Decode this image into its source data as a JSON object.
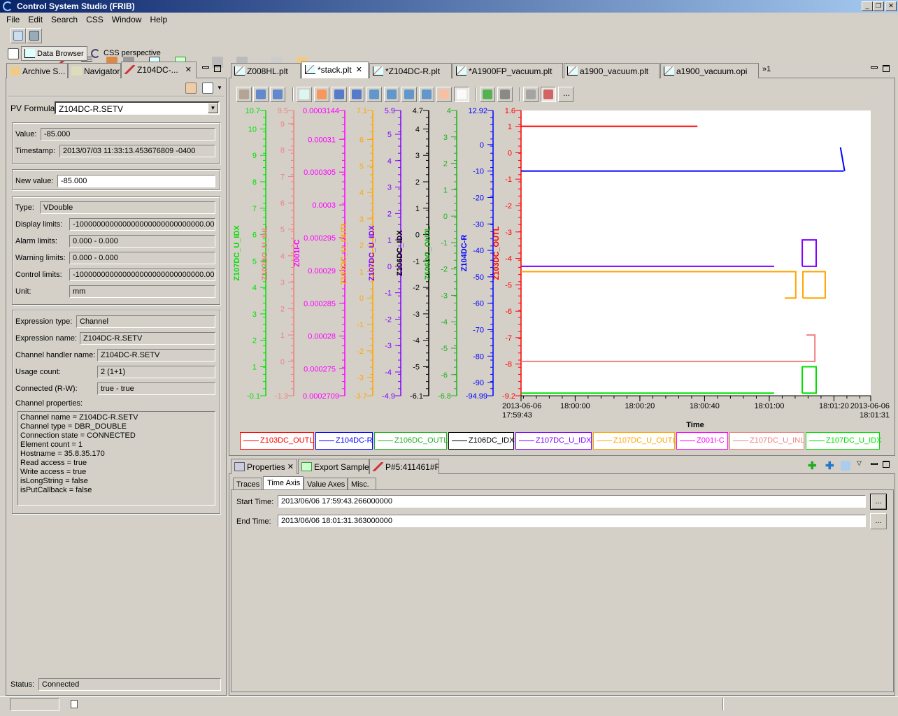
{
  "window": {
    "title": "Control System Studio (FRIB)",
    "controls": [
      "_",
      "❐",
      "✕"
    ]
  },
  "menu": [
    "File",
    "Edit",
    "Search",
    "CSS",
    "Window",
    "Help"
  ],
  "perspectives": {
    "data_browser": "Data Browser",
    "css": "CSS perspective"
  },
  "left_tabs": [
    "Archive S...",
    "Navigator",
    "Z104DC-..."
  ],
  "pv": {
    "formula_label": "PV Formula:",
    "formula_value": "Z104DC-R.SETV",
    "value_label": "Value:",
    "value": "-85.000",
    "timestamp_label": "Timestamp:",
    "timestamp": "2013/07/03 11:33:13.453676809 -0400",
    "new_value_label": "New value:",
    "new_value": "-85.000",
    "type_label": "Type:",
    "type": "VDouble",
    "display_limits_label": "Display limits:",
    "display_limits": "-100000000000000000000000000000.000",
    "alarm_limits_label": "Alarm limits:",
    "alarm_limits": "0.000 - 0.000",
    "warning_limits_label": "Warning limits:",
    "warning_limits": "0.000 - 0.000",
    "control_limits_label": "Control limits:",
    "control_limits": "-100000000000000000000000000000.000",
    "unit_label": "Unit:",
    "unit": "mm",
    "expr_type_label": "Expression type:",
    "expr_type": "Channel",
    "expr_name_label": "Expression name:",
    "expr_name": "Z104DC-R.SETV",
    "handler_label": "Channel handler name:",
    "handler": "Z104DC-R.SETV",
    "usage_label": "Usage count:",
    "usage": "2 (1+1)",
    "connected_label": "Connected (R-W):",
    "connected": "true - true",
    "props_label": "Channel properties:",
    "props": [
      "Channel name = Z104DC-R.SETV",
      "Channel type = DBR_DOUBLE",
      "Connection state = CONNECTED",
      "Element count = 1",
      "Hostname = 35.8.35.170",
      "Read access = true",
      "Write access = true",
      "isLongString = false",
      "isPutCallback = false"
    ],
    "status_label": "Status:",
    "status": "Connected"
  },
  "editor_tabs": [
    "Z008HL.plt",
    "*stack.plt",
    "*Z104DC-R.plt",
    "*A1900FP_vacuum.plt",
    "a1900_vacuum.plt",
    "a1900_vacuum.opi"
  ],
  "editor_overflow": "»1",
  "chart_toolbar": [
    "config-icon",
    "add-axis-icon",
    "remove-axis-icon",
    "stagger-icon",
    "zoom-box-icon",
    "horizontal-zoom-icon",
    "vertical-zoom-icon",
    "zoom-in-x-icon",
    "zoom-out-x-icon",
    "zoom-in-y-icon",
    "zoom-out-y-icon",
    "pan-icon",
    "pointer-icon",
    "undo-icon",
    "redo-icon",
    "snapshot-icon",
    "remove-annotation-icon",
    "more"
  ],
  "chart_more": "...",
  "chart_data": {
    "type": "line",
    "xlabel": "Time",
    "xrange": [
      "2013-06-06 17:59:43.266",
      "2013-06-06 18:01:31.363"
    ],
    "xticks": [
      {
        "t": "17:59:43.266",
        "label": [
          "2013-06-06",
          "17:59:43"
        ]
      },
      {
        "t": "18:00:00",
        "label": [
          "18:00:00"
        ]
      },
      {
        "t": "18:00:20",
        "label": [
          "18:00:20"
        ]
      },
      {
        "t": "18:00:40",
        "label": [
          "18:00:40"
        ]
      },
      {
        "t": "18:01:00",
        "label": [
          "18:01:00"
        ]
      },
      {
        "t": "18:01:20",
        "label": [
          "18:01:20"
        ]
      },
      {
        "t": "18:01:31.363",
        "label": [
          "2013-06-06",
          "18:01:31"
        ]
      }
    ],
    "axes": [
      {
        "name": "Z107DC_U_IDX",
        "color": "#00e000",
        "min": -0.1,
        "max": 10.7,
        "ticks": [
          1,
          2,
          3,
          4,
          5,
          6,
          7,
          8,
          9,
          10
        ]
      },
      {
        "name": "Z107DC_U_INL",
        "color": "#f08080",
        "min": -1.3,
        "max": 9.5,
        "ticks": [
          0,
          1,
          2,
          3,
          4,
          5,
          6,
          7,
          8,
          9
        ]
      },
      {
        "name": "Z001I-C",
        "color": "#ff00ff",
        "min": 0.0002709,
        "max": 0.0003144,
        "ticks": [
          0.000275,
          0.00028,
          0.000285,
          0.00029,
          0.000295,
          0.0003,
          0.000305,
          0.00031
        ]
      },
      {
        "name": "Z107DC_U_OUTL",
        "color": "#ffa500",
        "min": -3.7,
        "max": 7.1,
        "ticks": [
          -3,
          -2,
          -1,
          0,
          1,
          2,
          3,
          4,
          5,
          6
        ]
      },
      {
        "name": "Z107DC_U_IDX",
        "color": "#8000ff",
        "min": -4.9,
        "max": 5.9,
        "ticks": [
          -4,
          -3,
          -2,
          -1,
          0,
          1,
          2,
          3,
          4,
          5
        ]
      },
      {
        "name": "Z106DC_IDX",
        "color": "#000000",
        "min": -6.1,
        "max": 4.7,
        "ticks": [
          -5,
          -4,
          -3,
          -2,
          -1,
          0,
          1,
          2,
          3,
          4
        ]
      },
      {
        "name": "Z106DC_OUTL",
        "color": "#20b020",
        "min": -6.8,
        "max": 4,
        "ticks": [
          -6,
          -5,
          -4,
          -3,
          -2,
          -1,
          0,
          1,
          2,
          3
        ]
      },
      {
        "name": "Z104DC-R",
        "color": "#0000ff",
        "min": -94.99,
        "max": 12.92,
        "ticks": [
          -90,
          -80,
          -70,
          -60,
          -50,
          -40,
          -30,
          -20,
          -10,
          0
        ]
      },
      {
        "name": "Z103DC_OUTL",
        "color": "#ff0000",
        "min": -9.2,
        "max": 1.6,
        "ticks": [
          -8,
          -7,
          -6,
          -5,
          -4,
          -3,
          -2,
          -1,
          0,
          1
        ]
      }
    ],
    "traces": [
      {
        "axis": 8,
        "segments": [
          [
            [
              "17:59:43.3",
              1
            ],
            [
              "18:00:37.8",
              1
            ]
          ]
        ]
      },
      {
        "axis": 7,
        "segments": [
          [
            [
              "17:59:43.3",
              -10
            ],
            [
              "18:01:23.0",
              -10
            ]
          ],
          [
            [
              "18:01:22.0",
              -1
            ],
            [
              "18:01:23.3",
              -10
            ]
          ]
        ]
      },
      {
        "axis": 4,
        "segments": [
          [
            [
              "17:59:43.3",
              0
            ],
            [
              "18:01:01.5",
              0
            ]
          ],
          [
            [
              "18:01:10.2",
              0
            ],
            [
              "18:01:10.2",
              1
            ],
            [
              "18:01:14.5",
              1
            ],
            [
              "18:01:14.5",
              0
            ],
            [
              "18:01:10.2",
              0
            ]
          ]
        ]
      },
      {
        "axis": 3,
        "segments": [
          [
            [
              "17:59:43.3",
              1
            ],
            [
              "18:01:08.2",
              1
            ],
            [
              "18:01:08.2",
              0
            ],
            [
              "18:01:04.8",
              0
            ]
          ],
          [
            [
              "18:01:10.4",
              0
            ],
            [
              "18:01:10.4",
              1
            ],
            [
              "18:01:17.3",
              1
            ],
            [
              "18:01:17.3",
              0
            ],
            [
              "18:01:10.4",
              0
            ]
          ]
        ]
      },
      {
        "axis": 1,
        "segments": [
          [
            [
              "17:59:43.3",
              0
            ],
            [
              "18:01:14.1",
              0
            ],
            [
              "18:01:14.1",
              1
            ],
            [
              "18:01:11.5",
              1
            ]
          ]
        ]
      },
      {
        "axis": 0,
        "segments": [
          [
            [
              "17:59:43.3",
              0
            ],
            [
              "18:01:01.5",
              0
            ]
          ],
          [
            [
              "18:01:10.2",
              0
            ],
            [
              "18:01:10.2",
              1
            ],
            [
              "18:01:14.5",
              1
            ],
            [
              "18:01:14.5",
              0
            ],
            [
              "18:01:10.2",
              0
            ]
          ]
        ]
      }
    ],
    "legend": [
      {
        "name": "Z103DC_OUTL",
        "color": "#ff0000"
      },
      {
        "name": "Z104DC-R",
        "color": "#0000ff"
      },
      {
        "name": "Z106DC_OUTL",
        "color": "#20b020"
      },
      {
        "name": "Z106DC_IDX",
        "color": "#000000"
      },
      {
        "name": "Z107DC_U_IDX",
        "color": "#8000ff"
      },
      {
        "name": "Z107DC_U_OUTL",
        "color": "#ffa500"
      },
      {
        "name": "Z001I-C",
        "color": "#ff00ff"
      },
      {
        "name": "Z107DC_U_INL",
        "color": "#f08080"
      },
      {
        "name": "Z107DC_U_IDX",
        "color": "#00e000"
      }
    ],
    "legend_placement": "bottom",
    "grid": false
  },
  "bottom_tabs": [
    "Properties",
    "Export Samples",
    "P#5:411461#F"
  ],
  "sub_tabs": [
    "Traces",
    "Time Axis",
    "Value Axes",
    "Misc."
  ],
  "time_axis": {
    "start_label": "Start Time:",
    "start": "2013/06/06 17:59:43.266000000",
    "end_label": "End Time:",
    "end": "2013/06/06 18:01:31.363000000",
    "browse": "..."
  }
}
